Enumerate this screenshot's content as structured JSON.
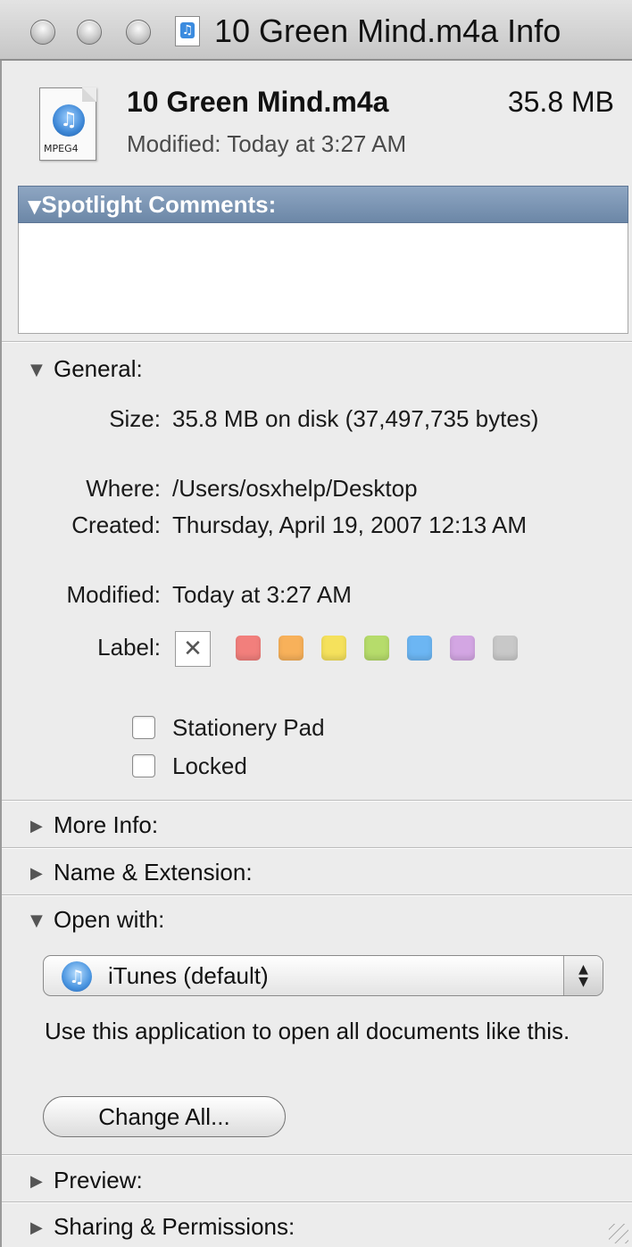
{
  "window": {
    "title": "10 Green Mind.m4a Info"
  },
  "header": {
    "file_name": "10 Green Mind.m4a",
    "file_size": "35.8 MB",
    "modified": "Modified: Today at 3:27 AM",
    "icon_tag": "MPEG4"
  },
  "spotlight": {
    "label": "Spotlight Comments:",
    "value": ""
  },
  "general": {
    "label": "General:",
    "size_label": "Size:",
    "size_value": "35.8 MB on disk (37,497,735 bytes)",
    "where_label": "Where:",
    "where_value": "/Users/osxhelp/Desktop",
    "created_label": "Created:",
    "created_value": "Thursday, April 19, 2007 12:13 AM",
    "modified_label": "Modified:",
    "modified_value": "Today at 3:27 AM",
    "label_label": "Label:",
    "label_none_glyph": "✕",
    "label_colors": [
      "#f27f7c",
      "#f8b15a",
      "#f5e15c",
      "#b6dc6b",
      "#6cb6f3",
      "#d3a6e3",
      "#c8c8c8"
    ],
    "stationery_label": "Stationery Pad",
    "locked_label": "Locked"
  },
  "sections": {
    "more_info": "More Info:",
    "name_ext": "Name & Extension:",
    "open_with": "Open with:",
    "preview": "Preview:",
    "sharing": "Sharing & Permissions:"
  },
  "open_with": {
    "app": "iTunes (default)",
    "description": "Use this application to open all documents like this.",
    "change_all": "Change All..."
  }
}
